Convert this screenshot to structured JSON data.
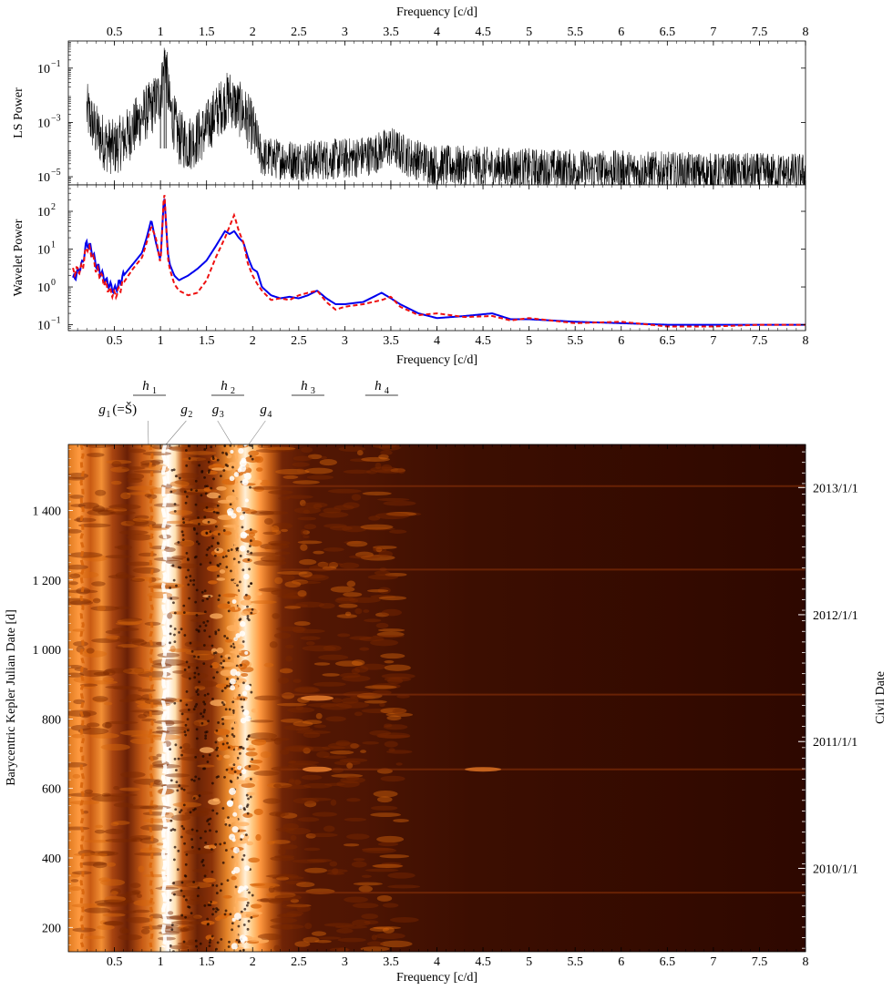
{
  "chart_data": [
    {
      "type": "line",
      "panel": "ls-periodogram",
      "title": "",
      "xlabel": "Frequency [c/d]",
      "ylabel": "LS Power",
      "xlim": [
        0,
        8
      ],
      "ylim": [
        5e-06,
        1
      ],
      "yscale": "log",
      "xticks": [
        "0.5",
        "1",
        "1.5",
        "2",
        "2.5",
        "3",
        "3.5",
        "4",
        "4.5",
        "5",
        "5.5",
        "6",
        "6.5",
        "7",
        "7.5",
        "8"
      ],
      "yticks": [
        {
          "value": 0.1,
          "base": "10",
          "exp": "−1"
        },
        {
          "value": 0.001,
          "base": "10",
          "exp": "−3"
        },
        {
          "value": 1e-05,
          "base": "10",
          "exp": "−5"
        }
      ],
      "series": [
        {
          "color": "#000000",
          "x": [
            0.2,
            0.3,
            0.4,
            0.5,
            0.6,
            0.7,
            0.8,
            0.9,
            1.0,
            1.03,
            1.05,
            1.1,
            1.2,
            1.3,
            1.4,
            1.5,
            1.6,
            1.7,
            1.75,
            1.8,
            1.9,
            2.0,
            2.1,
            2.5,
            3.0,
            3.3,
            3.5,
            3.7,
            4.0,
            5.0,
            6.0,
            7.0,
            8.0
          ],
          "y": [
            0.005,
            0.0008,
            0.0003,
            0.0002,
            0.0004,
            0.001,
            0.003,
            0.006,
            0.02,
            0.1,
            0.5,
            0.006,
            0.0005,
            0.0003,
            0.0005,
            0.001,
            0.004,
            0.01,
            0.015,
            0.008,
            0.004,
            0.001,
            8e-05,
            6e-05,
            7e-05,
            0.0001,
            0.0002,
            8e-05,
            4e-05,
            3e-05,
            2.5e-05,
            2e-05,
            2e-05
          ]
        }
      ]
    },
    {
      "type": "line",
      "panel": "wavelet-power",
      "title": "",
      "xlabel": "Frequency [c/d]",
      "ylabel": "Wavelet Power",
      "xlim": [
        0,
        8
      ],
      "ylim": [
        0.07,
        500
      ],
      "yscale": "log",
      "xticks": [
        "0.5",
        "1",
        "1.5",
        "2",
        "2.5",
        "3",
        "3.5",
        "4",
        "4.5",
        "5",
        "5.5",
        "6",
        "6.5",
        "7",
        "7.5",
        "8"
      ],
      "yticks": [
        {
          "value": 100,
          "base": "10",
          "exp": "2"
        },
        {
          "value": 10,
          "base": "10",
          "exp": "1"
        },
        {
          "value": 1,
          "base": "10",
          "exp": "0"
        },
        {
          "value": 0.1,
          "base": "10",
          "exp": "−1"
        }
      ],
      "series": [
        {
          "color": "#0000ee",
          "style": "solid",
          "x": [
            0.05,
            0.15,
            0.2,
            0.25,
            0.3,
            0.35,
            0.4,
            0.45,
            0.5,
            0.55,
            0.6,
            0.7,
            0.8,
            0.85,
            0.9,
            0.95,
            1.0,
            1.04,
            1.08,
            1.1,
            1.15,
            1.2,
            1.3,
            1.4,
            1.5,
            1.6,
            1.7,
            1.75,
            1.8,
            1.85,
            1.9,
            1.95,
            2.0,
            2.05,
            2.1,
            2.2,
            2.3,
            2.4,
            2.5,
            2.6,
            2.7,
            2.8,
            2.9,
            3.0,
            3.2,
            3.4,
            3.5,
            3.6,
            3.8,
            4.0,
            4.3,
            4.6,
            4.8,
            5.0,
            5.5,
            6.0,
            6.5,
            7.0,
            7.5,
            8.0
          ],
          "y": [
            1.5,
            4,
            15,
            10,
            4,
            2.5,
            1.5,
            1.1,
            0.8,
            1.2,
            2,
            4,
            8,
            20,
            60,
            15,
            5,
            300,
            8,
            4,
            2,
            1.5,
            2,
            3,
            5,
            12,
            30,
            25,
            30,
            20,
            15,
            6,
            3,
            2.5,
            1,
            0.6,
            0.5,
            0.55,
            0.5,
            0.6,
            0.8,
            0.5,
            0.35,
            0.35,
            0.4,
            0.7,
            0.5,
            0.35,
            0.2,
            0.15,
            0.17,
            0.2,
            0.14,
            0.14,
            0.12,
            0.11,
            0.1,
            0.1,
            0.1,
            0.1
          ]
        },
        {
          "color": "#ee1111",
          "style": "dashed",
          "x": [
            0.05,
            0.15,
            0.2,
            0.25,
            0.3,
            0.35,
            0.4,
            0.45,
            0.5,
            0.55,
            0.6,
            0.7,
            0.8,
            0.85,
            0.9,
            0.95,
            1.0,
            1.04,
            1.08,
            1.1,
            1.15,
            1.2,
            1.3,
            1.4,
            1.5,
            1.6,
            1.7,
            1.75,
            1.8,
            1.85,
            1.9,
            1.95,
            2.0,
            2.05,
            2.1,
            2.2,
            2.3,
            2.4,
            2.5,
            2.6,
            2.7,
            2.8,
            2.9,
            3.0,
            3.2,
            3.4,
            3.5,
            3.6,
            3.8,
            4.0,
            4.3,
            4.6,
            4.8,
            5.0,
            5.5,
            6.0,
            6.5,
            7.0,
            7.5,
            8.0
          ],
          "y": [
            2.5,
            3,
            12,
            8,
            3,
            2,
            1.2,
            0.8,
            0.6,
            0.8,
            1.3,
            3,
            6,
            15,
            40,
            20,
            4,
            400,
            6,
            3,
            1.2,
            0.8,
            0.6,
            0.7,
            1.5,
            6,
            20,
            40,
            80,
            30,
            15,
            4,
            2,
            1.2,
            0.8,
            0.45,
            0.5,
            0.45,
            0.6,
            0.7,
            0.8,
            0.4,
            0.25,
            0.3,
            0.35,
            0.45,
            0.55,
            0.3,
            0.18,
            0.2,
            0.16,
            0.17,
            0.13,
            0.15,
            0.11,
            0.12,
            0.09,
            0.09,
            0.1,
            0.1
          ]
        }
      ]
    },
    {
      "type": "heatmap",
      "panel": "wavelet-map",
      "title": "",
      "xlabel": "Frequency [c/d]",
      "ylabel": "Barycentric Kepler Julian Date [d]",
      "ylabel_right": "Civil Date",
      "xlim": [
        0,
        8
      ],
      "ylim": [
        130,
        1590
      ],
      "xticks": [
        "0.5",
        "1",
        "1.5",
        "2",
        "2.5",
        "3",
        "3.5",
        "4",
        "4.5",
        "5",
        "5.5",
        "6",
        "6.5",
        "7",
        "7.5",
        "8"
      ],
      "yticks": [
        "200",
        "400",
        "600",
        "800",
        "1 000",
        "1 200",
        "1 400"
      ],
      "yticks_right": [
        {
          "value": 370,
          "label": "2010/1/1"
        },
        {
          "value": 735,
          "label": "2011/1/1"
        },
        {
          "value": 1100,
          "label": "2012/1/1"
        },
        {
          "value": 1466,
          "label": "2013/1/1"
        }
      ],
      "colormap": [
        "#2a0800",
        "#7a2800",
        "#d8650c",
        "#ffb060",
        "#ffffff"
      ],
      "ridges": [
        {
          "x": 1.04,
          "intensity": 1.0
        },
        {
          "x": 1.82,
          "intensity": 0.85
        },
        {
          "x": 0.9,
          "intensity": 0.6
        },
        {
          "x": 0.15,
          "intensity": 0.6
        }
      ],
      "harmonic_labels": [
        {
          "label": "h",
          "sub": "1",
          "x": 0.88
        },
        {
          "label": "h",
          "sub": "2",
          "x": 1.73
        },
        {
          "label": "h",
          "sub": "3",
          "x": 2.6
        },
        {
          "label": "h",
          "sub": "4",
          "x": 3.4
        }
      ],
      "group_labels": [
        {
          "label": "g",
          "sub": "1",
          "suffix": "(=Š)",
          "x": 0.87
        },
        {
          "label": "g",
          "sub": "2",
          "suffix": "",
          "x": 1.05
        },
        {
          "label": "g",
          "sub": "3",
          "suffix": "",
          "x": 1.78
        },
        {
          "label": "g",
          "sub": "4",
          "suffix": "",
          "x": 1.95
        }
      ]
    }
  ]
}
